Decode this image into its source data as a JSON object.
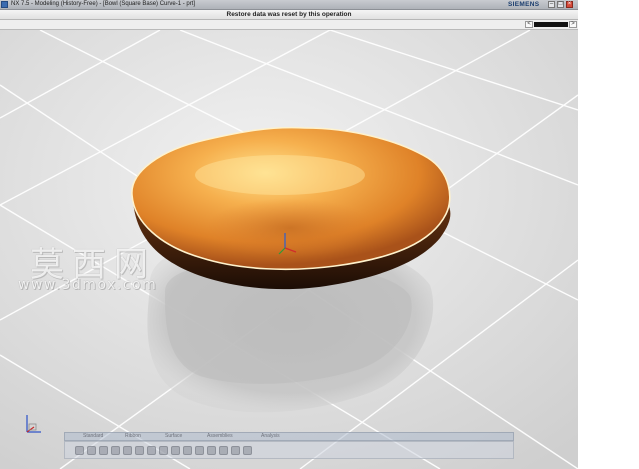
{
  "window": {
    "title": "NX 7.5 - Modeling (History-Free) - [Bowl (Square Base) Curve-1 - prt]",
    "brand": "SIEMENS",
    "minimize_symbol": "–",
    "restore_symbol": "□",
    "close_symbol": "×"
  },
  "cue_line": {
    "message": "Restore data was reset by this operation"
  },
  "status_bar": {
    "back_symbol": "<",
    "forward_symbol": ">"
  },
  "watermark": {
    "chinese": "莫西网",
    "url": "www.3dmox.com"
  },
  "ribbon": {
    "tabs": [
      "Standard",
      "Ribbon",
      "Surface",
      "Assemblies",
      "Analysis"
    ],
    "icons": [
      "new-icon",
      "open-icon",
      "save-icon",
      "undo-icon",
      "redo-icon",
      "cut-icon",
      "copy-icon",
      "paste-icon",
      "delete-icon",
      "fit-icon",
      "zoom-icon",
      "rotate-icon",
      "pan-icon",
      "shade-icon",
      "wireframe-icon"
    ]
  },
  "colors": {
    "bowl_inner": "#f0a040",
    "bowl_outer": "#3a1e0c",
    "rim": "#fff0c8",
    "floor": "#dcdcdc"
  },
  "icons": {
    "app": "nx-app-icon",
    "triad": "wcs-triad-icon"
  }
}
